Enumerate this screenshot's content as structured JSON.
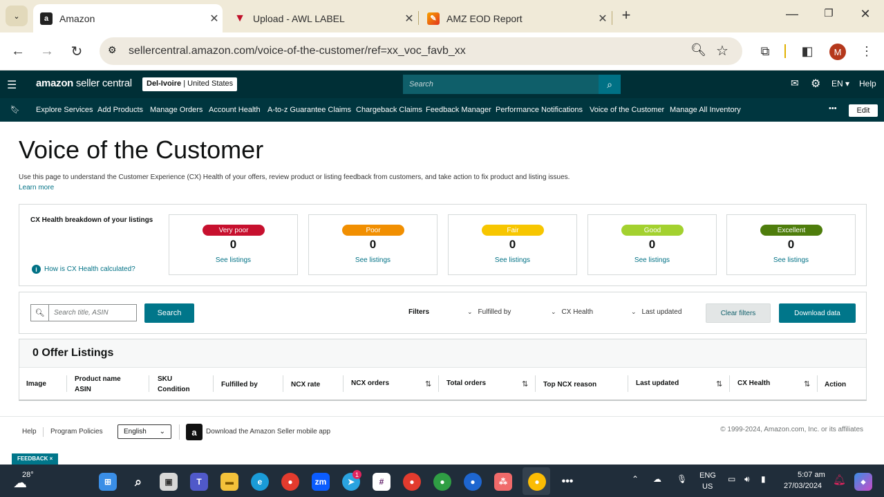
{
  "browser": {
    "tabs": [
      {
        "title": "Amazon",
        "favicon": "amazon-icon",
        "active": true
      },
      {
        "title": "Upload - AWL LABEL",
        "favicon": "awl-icon",
        "active": false
      },
      {
        "title": "AMZ EOD Report",
        "favicon": "report-icon",
        "active": false
      }
    ],
    "new_tab": "+",
    "url": "sellercentral.amazon.com/voice-of-the-customer/ref=xx_voc_favb_xx",
    "profile_initial": "M"
  },
  "header": {
    "logo_bold": "amazon",
    "logo_light": " seller central",
    "store_name": "Del-Ivoire",
    "store_region": "United States",
    "search_placeholder": "Search",
    "lang": "EN ▾",
    "help": "Help"
  },
  "nav": {
    "items": [
      "Explore Services",
      "Add Products",
      "Manage Orders",
      "Account Health",
      "A-to-z Guarantee Claims",
      "Chargeback Claims",
      "Feedback Manager",
      "Performance Notifications",
      "Voice of the Customer",
      "Manage All Inventory"
    ],
    "more": "•••",
    "edit": "Edit"
  },
  "page": {
    "title": "Voice of the Customer",
    "description": "Use this page to understand the Customer Experience (CX) Health of your offers, review product or listing feedback from customers, and take action to fix product and listing issues.",
    "learn_more": "Learn more"
  },
  "cx_health": {
    "title": "CX Health breakdown of your listings",
    "help_link": "How is CX Health calculated?",
    "cards": [
      {
        "label": "Very poor",
        "count": "0",
        "link": "See listings",
        "color": "#c7102e",
        "text_color": "#ffffff"
      },
      {
        "label": "Poor",
        "count": "0",
        "link": "See listings",
        "color": "#f18f01",
        "text_color": "#ffffff"
      },
      {
        "label": "Fair",
        "count": "0",
        "link": "See listings",
        "color": "#f7c600",
        "text_color": "#ffffff"
      },
      {
        "label": "Good",
        "count": "0",
        "link": "See listings",
        "color": "#a3d12f",
        "text_color": "#ffffff"
      },
      {
        "label": "Excellent",
        "count": "0",
        "link": "See listings",
        "color": "#4e7d0c",
        "text_color": "#ffffff"
      }
    ]
  },
  "filters": {
    "search_placeholder": "Search title, ASIN",
    "search_button": "Search",
    "label": "Filters",
    "dropdowns": [
      "Fulfilled by",
      "CX Health",
      "Last updated"
    ],
    "clear": "Clear filters",
    "download": "Download data"
  },
  "listings": {
    "count_label": "0 Offer Listings",
    "columns": [
      {
        "line1": "Image",
        "line2": ""
      },
      {
        "line1": "Product name",
        "line2": "ASIN"
      },
      {
        "line1": "SKU",
        "line2": "Condition"
      },
      {
        "line1": "Fulfilled by",
        "line2": ""
      },
      {
        "line1": "NCX rate",
        "line2": ""
      },
      {
        "line1": "NCX orders",
        "line2": ""
      },
      {
        "line1": "Total orders",
        "line2": ""
      },
      {
        "line1": "Top NCX reason",
        "line2": ""
      },
      {
        "line1": "Last updated",
        "line2": ""
      },
      {
        "line1": "CX Health",
        "line2": ""
      },
      {
        "line1": "Action",
        "line2": ""
      }
    ]
  },
  "footer": {
    "help": "Help",
    "policies": "Program Policies",
    "language": "English",
    "app_text": "Download the Amazon Seller mobile app",
    "copyright": "© 1999-2024, Amazon.com, Inc. or its affiliates",
    "feedback": "FEEDBACK ×"
  },
  "taskbar": {
    "temperature": "28°",
    "lang_top": "ENG",
    "lang_bottom": "US",
    "time": "5:07 am",
    "date": "27/03/2024",
    "telegram_badge": "1"
  }
}
